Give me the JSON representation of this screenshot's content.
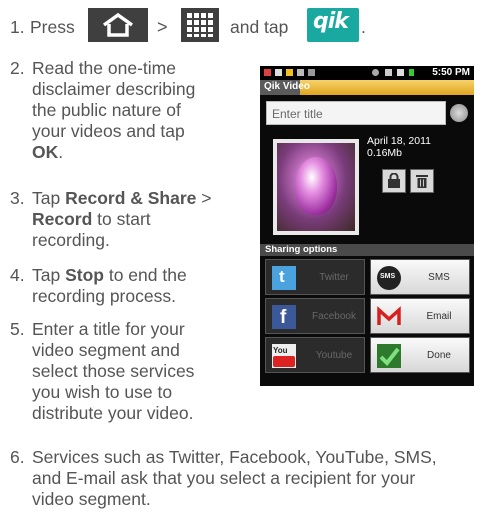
{
  "steps": [
    {
      "num": "1.",
      "press": "Press",
      "gt": ">",
      "and_tap": "and tap",
      "end": "."
    },
    {
      "num": "2.",
      "lines": [
        "Read the one-time",
        "disclaimer describing",
        "the public nature of",
        "your videos and tap"
      ],
      "bold": "OK",
      "after": "."
    },
    {
      "num": "3.",
      "tap": "Tap",
      "bold1": "Record & Share",
      "gt": ">",
      "bold2": "Record",
      "rest1": " to start",
      "rest2": "recording."
    },
    {
      "num": "4.",
      "tap": "Tap",
      "bold": "Stop",
      "rest1": " to end the",
      "rest2": "recording process."
    },
    {
      "num": "5.",
      "lines": [
        "Enter a title for your",
        "video segment and",
        "select those services",
        "you wish to use to",
        "distribute your video."
      ]
    },
    {
      "num": "6.",
      "lines": [
        "Services such as Twitter, Facebook, YouTube, SMS,",
        "and E-mail ask that you select a recipient for your",
        "video segment."
      ]
    }
  ],
  "icons": {
    "home": "home-icon",
    "apps": "apps-grid-icon",
    "qik": "qik"
  },
  "phone": {
    "time": "5:50 PM",
    "app_title": "Qik Video",
    "title_placeholder": "Enter title",
    "date": "April 18, 2011",
    "size": "0.16Mb",
    "sharing_header": "Sharing options",
    "services": [
      {
        "label": "Twitter",
        "state": "disabled"
      },
      {
        "label": "SMS",
        "state": "enabled"
      },
      {
        "label": "Facebook",
        "state": "disabled"
      },
      {
        "label": "Email",
        "state": "enabled"
      },
      {
        "label": "Youtube",
        "state": "disabled"
      },
      {
        "label": "Done",
        "state": "enabled"
      }
    ]
  },
  "colors": {
    "text": "#555555",
    "qik_teal": "#19a9a0",
    "titlebar": "#e8b33a"
  }
}
